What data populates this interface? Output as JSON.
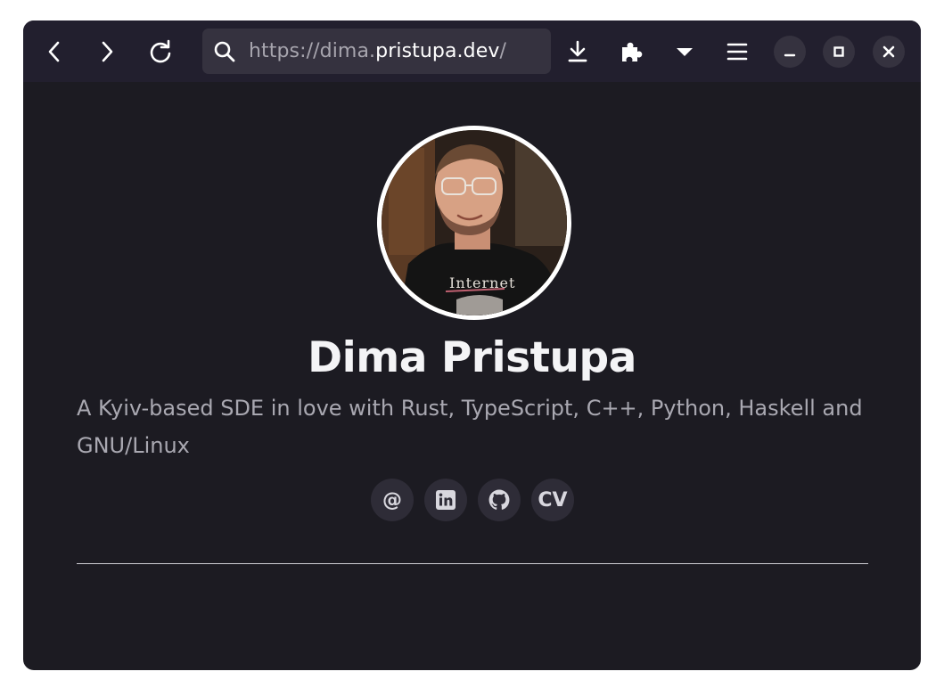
{
  "browser": {
    "url_prefix": "https://dima.",
    "url_domain": "pristupa.dev",
    "url_suffix": "/",
    "icons": [
      "back-icon",
      "forward-icon",
      "reload-icon",
      "search-icon",
      "download-icon",
      "extensions-icon",
      "dropdown-icon",
      "menu-icon",
      "minimize-icon",
      "maximize-icon",
      "close-icon"
    ]
  },
  "profile": {
    "name": "Dima Pristupa",
    "tagline": "A Kyiv-based SDE in love with Rust, TypeScript, C++, Python, Haskell and GNU/Linux",
    "shirt_text": "Internet"
  },
  "socials": {
    "email_symbol": "@",
    "cv_label": "CV",
    "icons": [
      "email-icon",
      "linkedin-icon",
      "github-icon"
    ]
  },
  "colors": {
    "page_background": "#1c1b22",
    "toolbar_background": "#221f2e",
    "urlbar_background": "#35323f",
    "text_primary": "#f4f4f6",
    "text_secondary": "#a9a8b1"
  }
}
